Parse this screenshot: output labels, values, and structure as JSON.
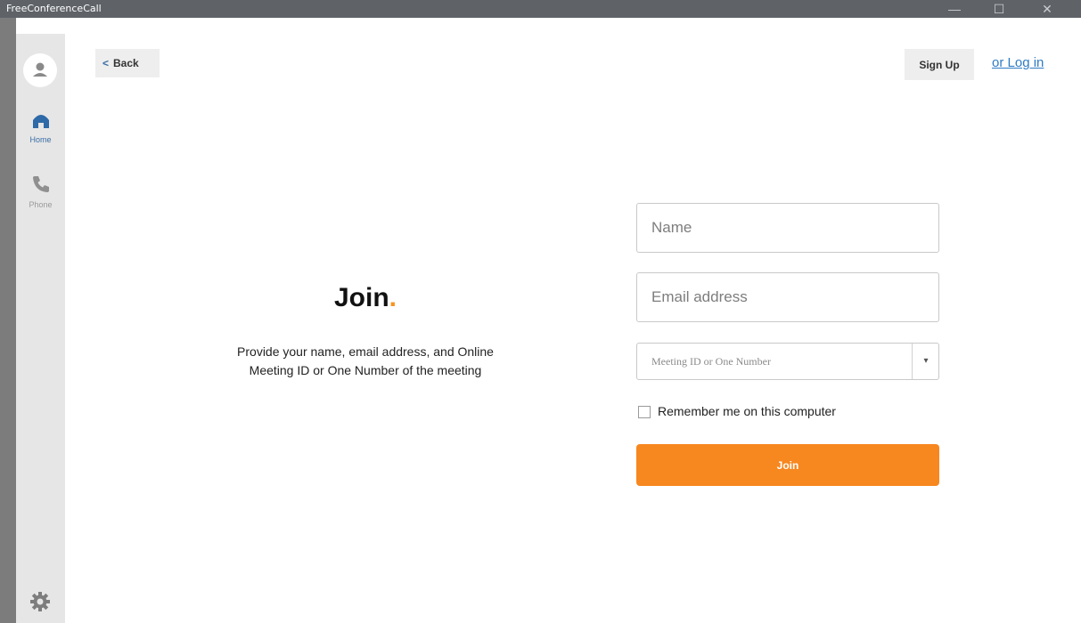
{
  "window": {
    "title": "FreeConferenceCall",
    "controls": {
      "minimize": "—",
      "maximize": "☐",
      "close": "✕"
    }
  },
  "sidebar": {
    "items": [
      {
        "label": "Home",
        "icon": "home-icon",
        "active": true
      },
      {
        "label": "Phone",
        "icon": "phone-icon",
        "active": false
      }
    ],
    "settings_icon": "gear-icon",
    "profile_icon": "avatar-icon"
  },
  "header": {
    "back_label": "Back",
    "signup_label": "Sign Up",
    "login_label": "or Log in"
  },
  "main": {
    "title": "Join",
    "title_dot": ".",
    "description": "Provide your name, email address, and Online Meeting ID or One Number of the meeting"
  },
  "form": {
    "name_placeholder": "Name",
    "email_placeholder": "Email address",
    "meeting_placeholder": "Meeting ID or One Number",
    "remember_label": "Remember me on this computer",
    "join_label": "Join"
  },
  "colors": {
    "accent": "#f7871f",
    "link": "#2f7bc5",
    "active_nav": "#3a6ea5",
    "titlebar": "#5f6368",
    "rail": "#e6e6e6"
  }
}
